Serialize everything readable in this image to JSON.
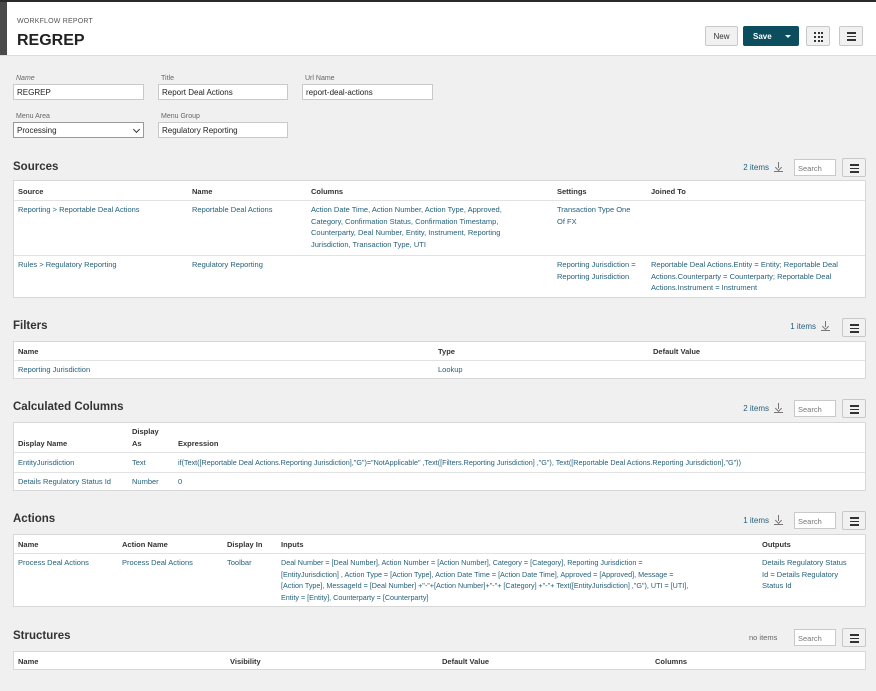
{
  "header": {
    "eyebrow": "WORKFLOW REPORT",
    "title": "REGREP",
    "new_label": "New",
    "save_label": "Save"
  },
  "form": {
    "name": {
      "label": "Name",
      "value": "REGREP"
    },
    "title": {
      "label": "Title",
      "value": "Report Deal Actions"
    },
    "url_name": {
      "label": "Url Name",
      "value": "report-deal-actions"
    },
    "menu_area": {
      "label": "Menu Area",
      "value": "Processing"
    },
    "menu_group": {
      "label": "Menu Group",
      "value": "Regulatory Reporting"
    }
  },
  "search_placeholder": "Search",
  "sources": {
    "title": "Sources",
    "count": "2 items",
    "headers": [
      "Source",
      "Name",
      "Columns",
      "Settings",
      "Joined To"
    ],
    "rows": [
      {
        "source": "Reporting > Reportable Deal Actions",
        "name": "Reportable Deal Actions",
        "columns": [
          "Action Date Time, Action Number, Action Type, Approved,",
          "Category, Confirmation Status, Confirmation Timestamp,",
          "Counterparty, Deal Number, Entity, Instrument, Reporting",
          "Jurisdiction, Transaction Type, UTI"
        ],
        "settings": [
          "Transaction Type One",
          "Of FX"
        ],
        "joined": []
      },
      {
        "source": "Rules > Regulatory Reporting",
        "name": "Regulatory Reporting",
        "columns": [],
        "settings": [
          "Reporting Jurisdiction =",
          "Reporting Jurisdiction"
        ],
        "joined": [
          "Reportable Deal Actions.Entity = Entity; Reportable Deal",
          "Actions.Counterparty = Counterparty; Reportable Deal",
          "Actions.Instrument = Instrument"
        ]
      }
    ]
  },
  "filters": {
    "title": "Filters",
    "count": "1 items",
    "headers": [
      "Name",
      "Type",
      "Default Value"
    ],
    "rows": [
      {
        "name": "Reporting Jurisdiction",
        "type": "Lookup",
        "default": ""
      }
    ]
  },
  "calculated": {
    "title": "Calculated Columns",
    "count": "2 items",
    "headers": [
      "Display Name",
      "Display",
      "As",
      "Expression"
    ],
    "rows": [
      {
        "name": "EntityJurisdiction",
        "as": "Text",
        "expr": "if(Text([Reportable Deal Actions.Reporting Jurisdiction],\"G\")=\"NotApplicable\" ,Text([Filters.Reporting Jurisdiction] ,\"G\"), Text([Reportable Deal Actions.Reporting Jurisdiction],\"G\"))"
      },
      {
        "name": "Details Regulatory Status Id",
        "as": "Number",
        "expr": "0"
      }
    ]
  },
  "actions": {
    "title": "Actions",
    "count": "1 items",
    "headers": [
      "Name",
      "Action Name",
      "Display In",
      "Inputs",
      "Outputs"
    ],
    "rows": [
      {
        "name": "Process Deal Actions",
        "action": "Process Deal Actions",
        "display": "Toolbar",
        "inputs": [
          "Deal Number = [Deal Number], Action Number = [Action Number], Category = [Category], Reporting Jurisdiction =",
          "[EntityJurisdiction] , Action Type = [Action Type], Action Date Time = [Action Date Time], Approved = [Approved], Message =",
          "[Action Type], MessageId =  [Deal Number] +\"-\"+[Action Number]+\"-\"+ [Category]  +\"-\"+ Text([EntityJurisdiction] ,\"G\"), UTI = [UTI],",
          "Entity = [Entity], Counterparty = [Counterparty]"
        ],
        "outputs": [
          "Details Regulatory Status",
          "Id = Details Regulatory",
          "Status Id"
        ]
      }
    ]
  },
  "structures": {
    "title": "Structures",
    "count": "no items",
    "headers": [
      "Name",
      "Visibility",
      "Default Value",
      "Columns"
    ]
  },
  "icons": {
    "download": "download-icon",
    "menu": "hamburger-icon",
    "grid": "grid-icon"
  }
}
